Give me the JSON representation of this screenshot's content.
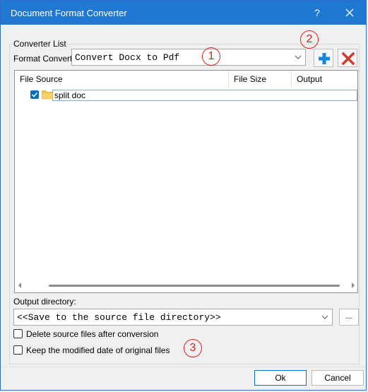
{
  "window": {
    "title": "Document Format Converter",
    "help_label": "?",
    "accent_color": "#1f78d1"
  },
  "converter_group": {
    "title": "Converter List",
    "format_label": "Format Convert",
    "format_value": "Convert Docx to Pdf",
    "add_icon": "plus-icon",
    "remove_icon": "x-icon"
  },
  "file_list": {
    "columns": [
      "File Source",
      "File Size",
      "Output"
    ],
    "rows": [
      {
        "name": "split doc",
        "checked": true,
        "icon": "folder-icon"
      }
    ]
  },
  "output": {
    "label": "Output directory:",
    "value": "<<Save to the source file directory>>",
    "browse_label": "..."
  },
  "options": [
    {
      "label": "Delete source files after conversion",
      "checked": false
    },
    {
      "label": "Keep the modified date of original files",
      "checked": false
    }
  ],
  "annotations": [
    "1",
    "2",
    "3"
  ],
  "buttons": {
    "ok": "Ok",
    "cancel": "Cancel"
  }
}
